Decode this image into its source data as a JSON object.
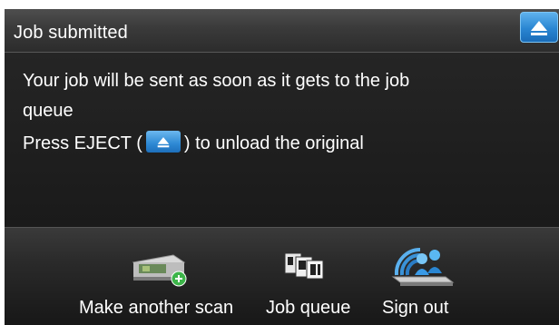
{
  "header": {
    "title": "Job submitted",
    "eject_icon": "eject-icon"
  },
  "message": {
    "line1": "Your job will be sent as soon as it gets to the job",
    "line2": "queue",
    "line3_prefix": "Press EJECT (",
    "line3_suffix": ") to unload the original"
  },
  "actions": [
    {
      "label": "Make another scan",
      "icon": "scanner-add-icon"
    },
    {
      "label": "Job queue",
      "icon": "job-queue-icon"
    },
    {
      "label": "Sign out",
      "icon": "sign-out-icon"
    }
  ],
  "colors": {
    "accent_blue": "#2a86d2",
    "background": "#1c1c1c",
    "plus_green": "#3db54a"
  }
}
